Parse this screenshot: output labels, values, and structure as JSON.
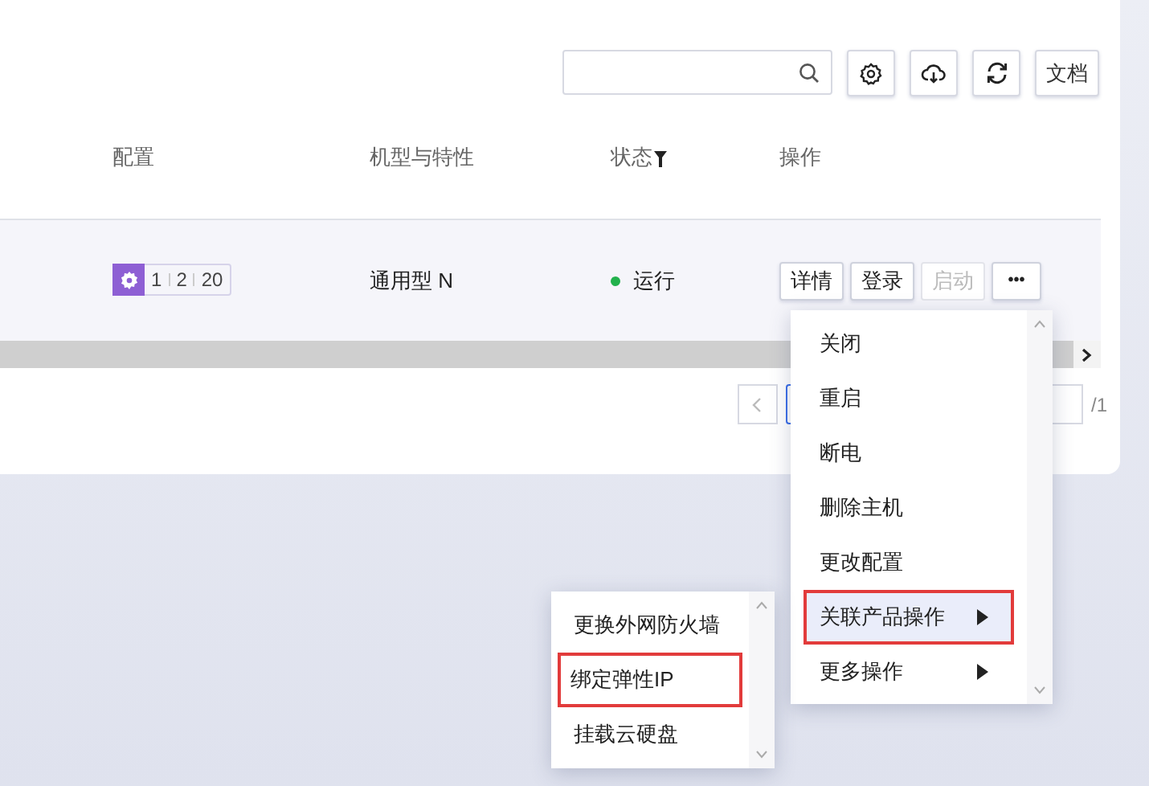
{
  "toolbar": {
    "doc_button": "文档"
  },
  "table": {
    "columns": [
      {
        "label": "配置",
        "filter": false
      },
      {
        "label": "机型与特性",
        "filter": false
      },
      {
        "label": "状态",
        "filter": true
      },
      {
        "label": "操作",
        "filter": false
      }
    ],
    "rows": [
      {
        "config": [
          "1",
          "2",
          "20"
        ],
        "type": "通用型 N",
        "status": {
          "text": "运行",
          "color": "#22b14c"
        },
        "actions": [
          {
            "label": "详情",
            "disabled": false
          },
          {
            "label": "登录",
            "disabled": false
          },
          {
            "label": "启动",
            "disabled": true
          }
        ],
        "more": "•••"
      }
    ]
  },
  "pagination": {
    "total": "/1"
  },
  "menu": {
    "items": [
      {
        "label": "关闭",
        "submenu": false,
        "selected": false,
        "highlighted": false
      },
      {
        "label": "重启",
        "submenu": false,
        "selected": false,
        "highlighted": false
      },
      {
        "label": "断电",
        "submenu": false,
        "selected": false,
        "highlighted": false
      },
      {
        "label": "删除主机",
        "submenu": false,
        "selected": false,
        "highlighted": false
      },
      {
        "label": "更改配置",
        "submenu": false,
        "selected": false,
        "highlighted": false
      },
      {
        "label": "关联产品操作",
        "submenu": true,
        "selected": true,
        "highlighted": true
      },
      {
        "label": "更多操作",
        "submenu": true,
        "selected": false,
        "highlighted": false
      }
    ]
  },
  "submenu": {
    "items": [
      {
        "label": "更换外网防火墙",
        "highlighted": false
      },
      {
        "label": "绑定弹性IP",
        "highlighted": true
      },
      {
        "label": "挂载云硬盘",
        "highlighted": false
      }
    ]
  }
}
